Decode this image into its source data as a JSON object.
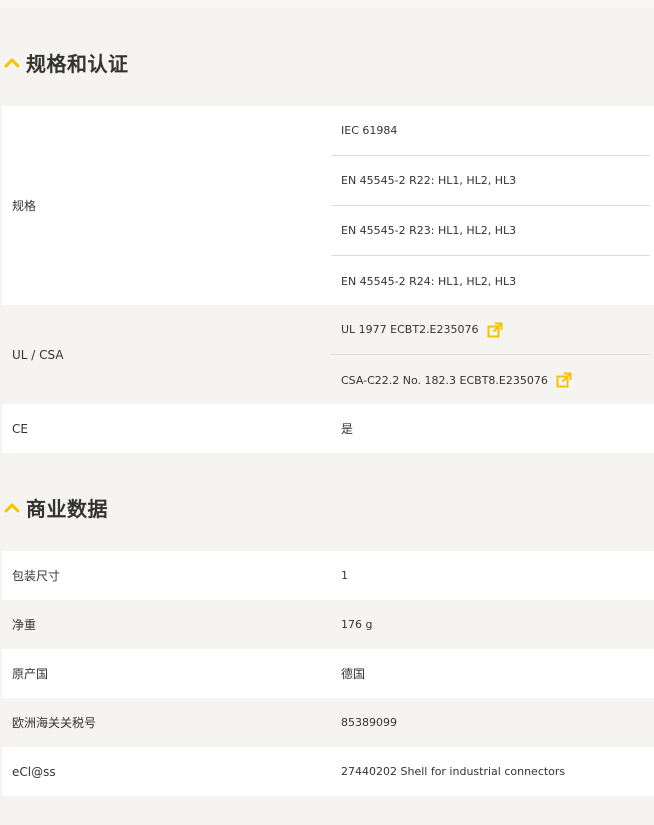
{
  "accent_color": "#f5c400",
  "sections": [
    {
      "title": "规格和认证",
      "icon": "chevron-up-icon",
      "rows": [
        {
          "label": "规格",
          "values": [
            {
              "text": "IEC 61984"
            },
            {
              "text": "EN 45545-2 R22: HL1, HL2, HL3"
            },
            {
              "text": "EN 45545-2 R23: HL1, HL2, HL3"
            },
            {
              "text": "EN 45545-2 R24: HL1, HL2, HL3"
            }
          ]
        },
        {
          "label": "UL / CSA",
          "values": [
            {
              "text": "UL 1977 ECBT2.E235076",
              "icon": "external-link-icon"
            },
            {
              "text": "CSA-C22.2 No. 182.3 ECBT8.E235076",
              "icon": "external-link-icon"
            }
          ]
        },
        {
          "label": "CE",
          "values": [
            {
              "text": "是"
            }
          ]
        }
      ]
    },
    {
      "title": "商业数据",
      "icon": "chevron-up-icon",
      "rows": [
        {
          "label": "包装尺寸",
          "values": [
            {
              "text": "1"
            }
          ]
        },
        {
          "label": "净重",
          "values": [
            {
              "text": "176 g"
            }
          ]
        },
        {
          "label": "原产国",
          "values": [
            {
              "text": "德国"
            }
          ]
        },
        {
          "label": "欧洲海关关税号",
          "values": [
            {
              "text": "85389099"
            }
          ]
        },
        {
          "label": "eCl@ss",
          "values": [
            {
              "text": "27440202 Shell for industrial connectors"
            }
          ]
        }
      ]
    }
  ]
}
